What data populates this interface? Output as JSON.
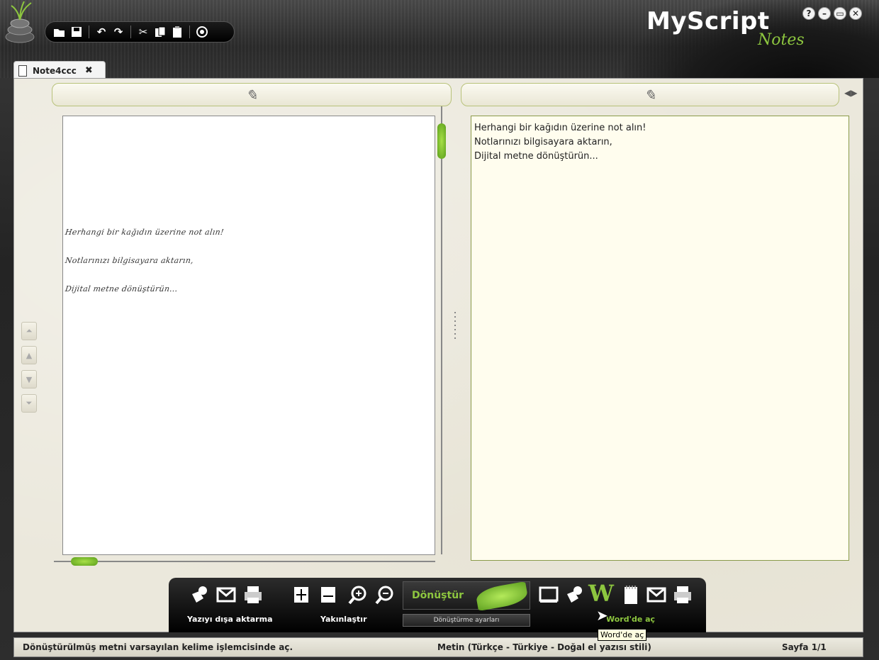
{
  "app": {
    "brand": "MyScript",
    "brand_sub": "Notes",
    "window_buttons": [
      "?",
      "–",
      "▭",
      "✕"
    ]
  },
  "top_toolbar": {
    "icons": [
      "open-icon",
      "save-icon",
      "undo-icon",
      "redo-icon",
      "cut-icon",
      "copy-icon",
      "paste-icon",
      "settings-icon"
    ]
  },
  "tab": {
    "label": "Note4ccc",
    "close": "✖"
  },
  "ink_panel": {
    "lines": [
      "Herhangi bir kağıdın üzerine not alın!",
      "Notlarınızı bilgisayara aktarın,",
      "Dijital metne dönüştürün..."
    ]
  },
  "text_panel": {
    "lines": [
      "Herhangi bir kağıdın üzerine not alın!",
      "Notlarınızı bilgisayara aktarın,",
      "Dijital metne dönüştürün..."
    ]
  },
  "bottom_toolbar": {
    "export_label": "Yazıyı dışa aktarma",
    "zoom_label": "Yakınlaştır",
    "convert_label": "Dönüştür",
    "convert_settings_label": "Dönüştürme ayarları",
    "word_label": "Word'de aç",
    "tooltip": "Word'de aç"
  },
  "status_bar": {
    "message": "Dönüştürülmüş metni varsayılan kelime işlemcisinde aç.",
    "language": "Metin (Türkçe - Türkiye - Doğal el yazısı stili)",
    "page": "Sayfa 1/1"
  }
}
